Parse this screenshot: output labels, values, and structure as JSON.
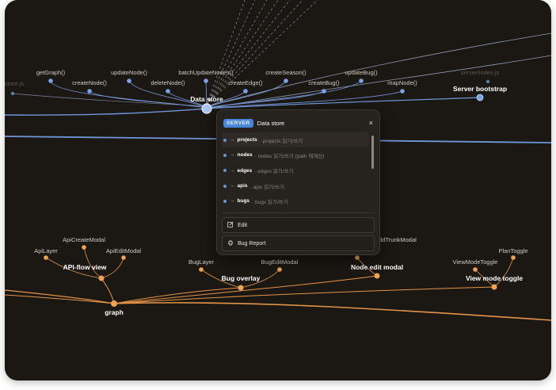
{
  "colors": {
    "background": "#1b1712",
    "blue_node": "#7aa2e8",
    "blue_edge": "#7fa6ea",
    "orange_node": "#f0a350",
    "orange_edge": "#e29449",
    "server_badge": "#4a86d8"
  },
  "graph": {
    "hubs": {
      "data_store": "Data store",
      "server_bootstrap": "Server bootstrap",
      "api_flow_view": "API-flow view",
      "bug_overlay": "Bug overlay",
      "node_edit_modal": "Node edit modal",
      "view_mode_toggle": "View mode toggle",
      "graph": "graph"
    },
    "blue_nodes": [
      "getGraph()",
      "createNode()",
      "updateNode()",
      "deleteNode()",
      "batchUpdateNodes()",
      "createEdge()",
      "createSeason()",
      "createBug()",
      "updateBug()",
      "mapNode()"
    ],
    "faded_labels": {
      "left": "store.js",
      "right": "server/index.js"
    },
    "orange_nodes": {
      "api_layer": "ApiLayer",
      "api_create_modal": "ApiCreateModal",
      "api_edit_modal": "ApiEditModal",
      "bug_layer": "BugLayer",
      "bug_edit_modal": "BugEditModal",
      "add_trunk_modal": "ddTrunkModal",
      "view_mode_toggle_comp": "ViewModeToggle",
      "plan_toggle": "PlanToggle"
    }
  },
  "panel": {
    "badge": "SERVER",
    "title": "Data store",
    "close": "×",
    "items": [
      {
        "name": "projects",
        "desc": "· projects 읽기/쓰기"
      },
      {
        "name": "nodes",
        "desc": "· nodes 읽기/쓰기 (path 재계산)"
      },
      {
        "name": "edges",
        "desc": "· edges 읽기/쓰기"
      },
      {
        "name": "apis",
        "desc": "· apis 읽기/쓰기"
      },
      {
        "name": "bugs",
        "desc": "· bugs 읽기/쓰기"
      }
    ],
    "arrow": "→",
    "edit_label": "Edit",
    "bug_report_label": "Bug Report"
  }
}
